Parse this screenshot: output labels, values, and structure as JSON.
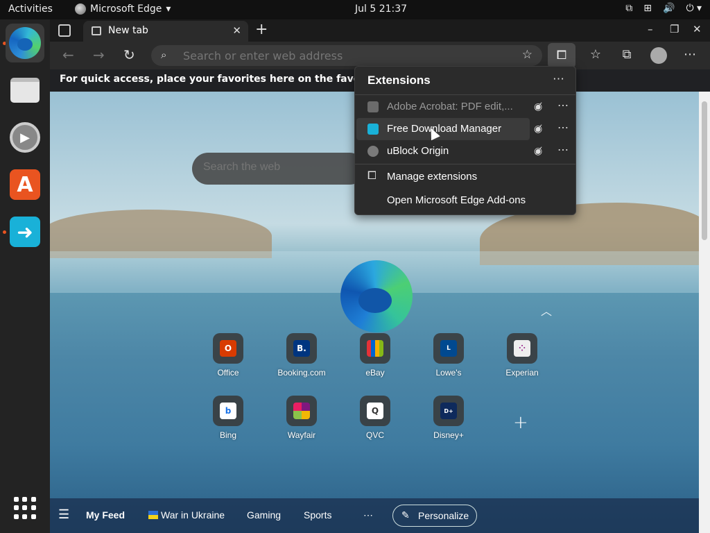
{
  "topbar": {
    "activities": "Activities",
    "app_name": "Microsoft Edge",
    "app_menu_arrow": "▾",
    "clock": "Jul 5  21:37",
    "tray_icons": [
      "screen-share-icon",
      "network-icon",
      "volume-icon",
      "power-icon"
    ]
  },
  "dock": {
    "items": [
      "microsoft-edge",
      "files",
      "settings",
      "ubuntu-software",
      "free-download-manager",
      "show-applications"
    ]
  },
  "browser": {
    "tab_title": "New tab",
    "tab_close": "✕",
    "new_tab": "+",
    "win_min": "–",
    "win_max": "❐",
    "win_close": "✕",
    "address_placeholder": "Search or enter web address",
    "favorites_bar_text": "For quick access, place your favorites here on the favorites ba",
    "more_menu": "⋯"
  },
  "extensions_popup": {
    "title": "Extensions",
    "header_more": "⋯",
    "items": [
      {
        "name": "Adobe Acrobat: PDF edit,...",
        "enabled": false,
        "icon_color": "#6b6b6b"
      },
      {
        "name": "Free Download Manager",
        "enabled": true,
        "icon_color": "#19b1d8"
      },
      {
        "name": "uBlock Origin",
        "enabled": true,
        "icon_color": "#7a7a7a"
      }
    ],
    "manage": "Manage extensions",
    "addons": "Open Microsoft Edge Add-ons"
  },
  "newtab": {
    "search_placeholder": "Search the web",
    "tiles_row1": [
      {
        "label": "Office",
        "color": "#d83b01",
        "glyph": "O"
      },
      {
        "label": "Booking.com",
        "color": "#003580",
        "glyph": "B."
      },
      {
        "label": "eBay",
        "color": "#3a3a3a",
        "glyph": "▦"
      },
      {
        "label": "Lowe's",
        "color": "#004990",
        "glyph": "L"
      },
      {
        "label": "Experian",
        "color": "#eeeeee",
        "glyph": "⁘"
      }
    ],
    "tiles_row2": [
      {
        "label": "Bing",
        "color": "#ffffff",
        "glyph": "b"
      },
      {
        "label": "Wayfair",
        "color": "#7f187f",
        "glyph": "◆"
      },
      {
        "label": "QVC",
        "color": "#ffffff",
        "glyph": "Q"
      },
      {
        "label": "Disney+",
        "color": "#0e2a5c",
        "glyph": "D+"
      }
    ],
    "add_tile": "+"
  },
  "feed": {
    "menu_glyph": "☰",
    "my_feed": "My Feed",
    "war": "War in Ukraine",
    "gaming": "Gaming",
    "sports": "Sports",
    "more": "⋯",
    "personalize": "Personalize"
  }
}
